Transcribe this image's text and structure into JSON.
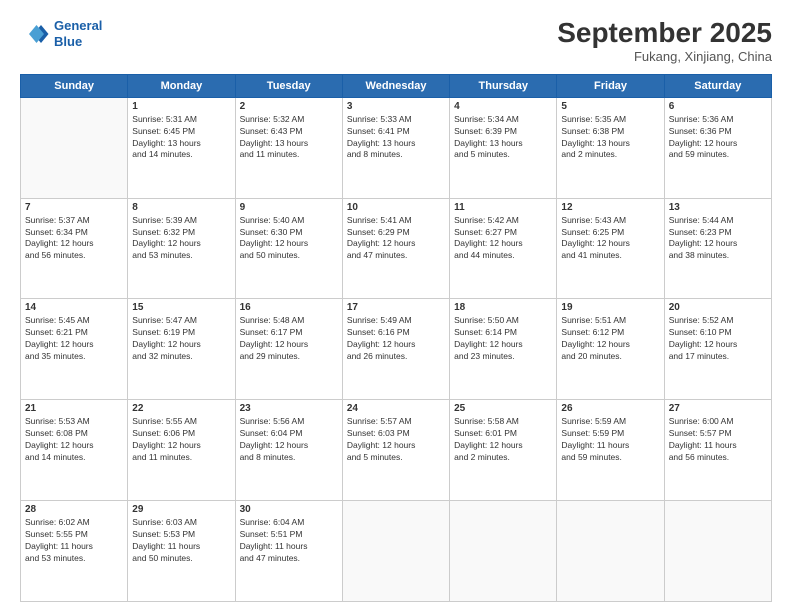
{
  "header": {
    "logo_line1": "General",
    "logo_line2": "Blue",
    "month": "September 2025",
    "location": "Fukang, Xinjiang, China"
  },
  "weekdays": [
    "Sunday",
    "Monday",
    "Tuesday",
    "Wednesday",
    "Thursday",
    "Friday",
    "Saturday"
  ],
  "weeks": [
    [
      {
        "day": "",
        "text": ""
      },
      {
        "day": "1",
        "text": "Sunrise: 5:31 AM\nSunset: 6:45 PM\nDaylight: 13 hours\nand 14 minutes."
      },
      {
        "day": "2",
        "text": "Sunrise: 5:32 AM\nSunset: 6:43 PM\nDaylight: 13 hours\nand 11 minutes."
      },
      {
        "day": "3",
        "text": "Sunrise: 5:33 AM\nSunset: 6:41 PM\nDaylight: 13 hours\nand 8 minutes."
      },
      {
        "day": "4",
        "text": "Sunrise: 5:34 AM\nSunset: 6:39 PM\nDaylight: 13 hours\nand 5 minutes."
      },
      {
        "day": "5",
        "text": "Sunrise: 5:35 AM\nSunset: 6:38 PM\nDaylight: 13 hours\nand 2 minutes."
      },
      {
        "day": "6",
        "text": "Sunrise: 5:36 AM\nSunset: 6:36 PM\nDaylight: 12 hours\nand 59 minutes."
      }
    ],
    [
      {
        "day": "7",
        "text": "Sunrise: 5:37 AM\nSunset: 6:34 PM\nDaylight: 12 hours\nand 56 minutes."
      },
      {
        "day": "8",
        "text": "Sunrise: 5:39 AM\nSunset: 6:32 PM\nDaylight: 12 hours\nand 53 minutes."
      },
      {
        "day": "9",
        "text": "Sunrise: 5:40 AM\nSunset: 6:30 PM\nDaylight: 12 hours\nand 50 minutes."
      },
      {
        "day": "10",
        "text": "Sunrise: 5:41 AM\nSunset: 6:29 PM\nDaylight: 12 hours\nand 47 minutes."
      },
      {
        "day": "11",
        "text": "Sunrise: 5:42 AM\nSunset: 6:27 PM\nDaylight: 12 hours\nand 44 minutes."
      },
      {
        "day": "12",
        "text": "Sunrise: 5:43 AM\nSunset: 6:25 PM\nDaylight: 12 hours\nand 41 minutes."
      },
      {
        "day": "13",
        "text": "Sunrise: 5:44 AM\nSunset: 6:23 PM\nDaylight: 12 hours\nand 38 minutes."
      }
    ],
    [
      {
        "day": "14",
        "text": "Sunrise: 5:45 AM\nSunset: 6:21 PM\nDaylight: 12 hours\nand 35 minutes."
      },
      {
        "day": "15",
        "text": "Sunrise: 5:47 AM\nSunset: 6:19 PM\nDaylight: 12 hours\nand 32 minutes."
      },
      {
        "day": "16",
        "text": "Sunrise: 5:48 AM\nSunset: 6:17 PM\nDaylight: 12 hours\nand 29 minutes."
      },
      {
        "day": "17",
        "text": "Sunrise: 5:49 AM\nSunset: 6:16 PM\nDaylight: 12 hours\nand 26 minutes."
      },
      {
        "day": "18",
        "text": "Sunrise: 5:50 AM\nSunset: 6:14 PM\nDaylight: 12 hours\nand 23 minutes."
      },
      {
        "day": "19",
        "text": "Sunrise: 5:51 AM\nSunset: 6:12 PM\nDaylight: 12 hours\nand 20 minutes."
      },
      {
        "day": "20",
        "text": "Sunrise: 5:52 AM\nSunset: 6:10 PM\nDaylight: 12 hours\nand 17 minutes."
      }
    ],
    [
      {
        "day": "21",
        "text": "Sunrise: 5:53 AM\nSunset: 6:08 PM\nDaylight: 12 hours\nand 14 minutes."
      },
      {
        "day": "22",
        "text": "Sunrise: 5:55 AM\nSunset: 6:06 PM\nDaylight: 12 hours\nand 11 minutes."
      },
      {
        "day": "23",
        "text": "Sunrise: 5:56 AM\nSunset: 6:04 PM\nDaylight: 12 hours\nand 8 minutes."
      },
      {
        "day": "24",
        "text": "Sunrise: 5:57 AM\nSunset: 6:03 PM\nDaylight: 12 hours\nand 5 minutes."
      },
      {
        "day": "25",
        "text": "Sunrise: 5:58 AM\nSunset: 6:01 PM\nDaylight: 12 hours\nand 2 minutes."
      },
      {
        "day": "26",
        "text": "Sunrise: 5:59 AM\nSunset: 5:59 PM\nDaylight: 11 hours\nand 59 minutes."
      },
      {
        "day": "27",
        "text": "Sunrise: 6:00 AM\nSunset: 5:57 PM\nDaylight: 11 hours\nand 56 minutes."
      }
    ],
    [
      {
        "day": "28",
        "text": "Sunrise: 6:02 AM\nSunset: 5:55 PM\nDaylight: 11 hours\nand 53 minutes."
      },
      {
        "day": "29",
        "text": "Sunrise: 6:03 AM\nSunset: 5:53 PM\nDaylight: 11 hours\nand 50 minutes."
      },
      {
        "day": "30",
        "text": "Sunrise: 6:04 AM\nSunset: 5:51 PM\nDaylight: 11 hours\nand 47 minutes."
      },
      {
        "day": "",
        "text": ""
      },
      {
        "day": "",
        "text": ""
      },
      {
        "day": "",
        "text": ""
      },
      {
        "day": "",
        "text": ""
      }
    ]
  ]
}
